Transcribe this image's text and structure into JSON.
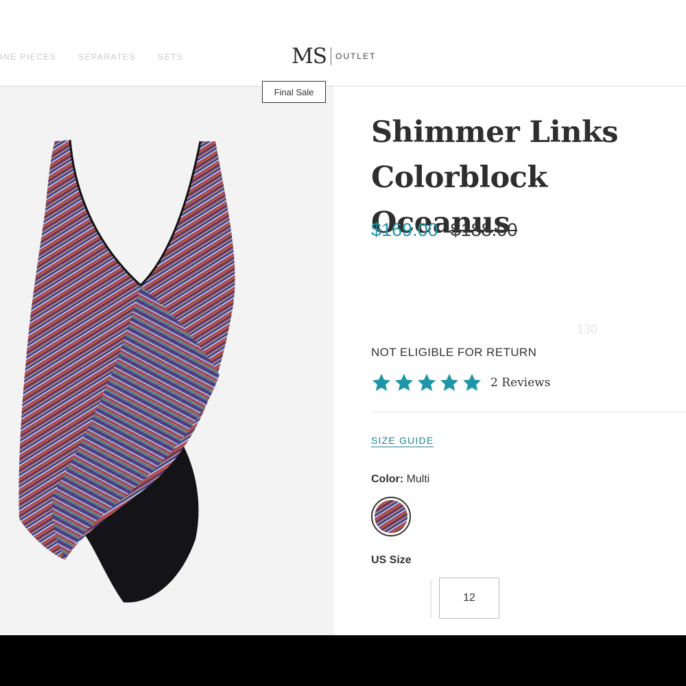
{
  "header": {
    "nav": [
      "ONE PIECES",
      "SEPARATES",
      "SETS"
    ],
    "logo_mark": "MS",
    "logo_text": "OUTLET"
  },
  "product": {
    "badge": "Final Sale",
    "title_line1": "Shimmer Links",
    "title_line2": "Colorblock Oceanus",
    "price_sale": "$169.00",
    "price_original": "$188.00",
    "ghost_text": "130",
    "return_policy": "NOT ELIGIBLE FOR RETURN",
    "rating": 5,
    "reviews_label": "2 Reviews",
    "size_guide_label": "SIZE GUIDE",
    "color_label": "Color:",
    "color_value": "Multi",
    "size_label": "US Size",
    "size_option": "12"
  },
  "colors": {
    "accent": "#1f95a8",
    "link": "#1f8295",
    "bottom_bar": "#000000"
  },
  "icons": {
    "star": "star-icon",
    "swatch": "multi-color-swatch"
  }
}
